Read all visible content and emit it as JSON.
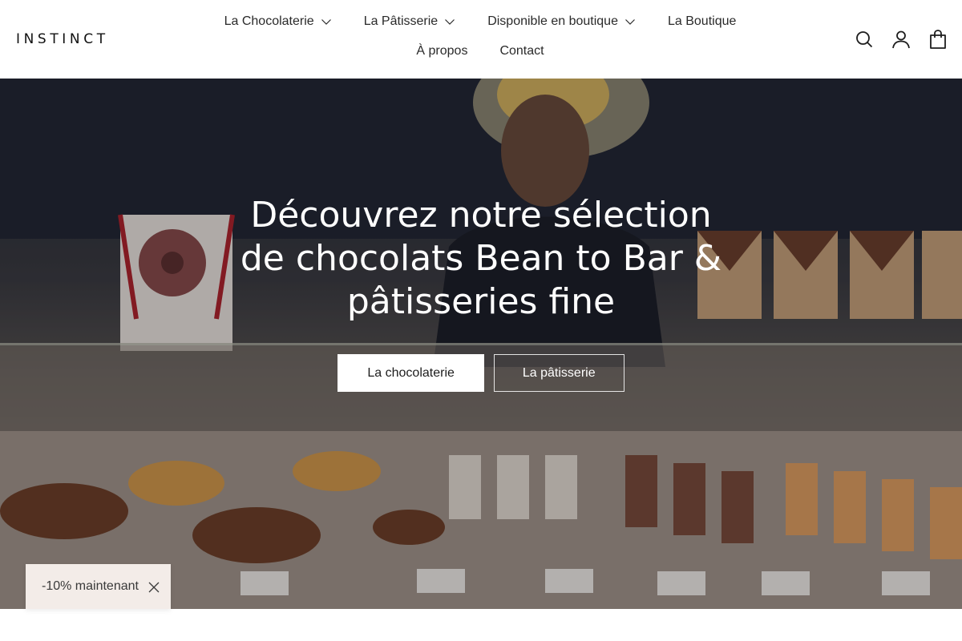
{
  "brand": {
    "logo": "INSTINCT"
  },
  "nav": {
    "items": [
      {
        "label": "La Chocolaterie",
        "has_dropdown": true
      },
      {
        "label": "La Pâtisserie",
        "has_dropdown": true
      },
      {
        "label": "Disponible en boutique",
        "has_dropdown": true
      },
      {
        "label": "La Boutique",
        "has_dropdown": false
      },
      {
        "label": "À propos",
        "has_dropdown": false
      },
      {
        "label": "Contact",
        "has_dropdown": false
      }
    ]
  },
  "header_icons": [
    "search-icon",
    "account-icon",
    "bag-icon"
  ],
  "hero": {
    "title": "Découvrez notre sélection de chocolats Bean to Bar & pâtisseries fine",
    "buttons": {
      "primary": "La chocolaterie",
      "secondary": "La pâtisserie"
    }
  },
  "promo": {
    "label": "-10% maintenant"
  },
  "colors": {
    "header_bg": "#ffffff",
    "text": "#1d1d1d",
    "promo_bg": "#f3ece8",
    "hero_text": "#ffffff"
  }
}
